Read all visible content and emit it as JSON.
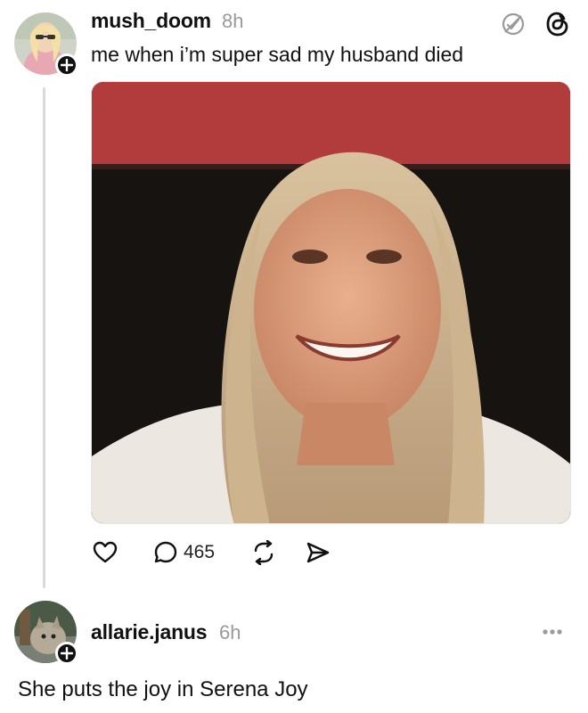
{
  "post": {
    "username": "mush_doom",
    "time": "8h",
    "text": "me when i’m super sad my husband died",
    "replies_count": "465",
    "icons": [
      "avatar",
      "follow-plus-icon",
      "muted-icon",
      "threads-logo-icon",
      "heart-icon",
      "reply-icon",
      "repost-icon",
      "share-icon"
    ]
  },
  "reply": {
    "username": "allarie.janus",
    "time": "6h",
    "text": "She puts the joy in Serena Joy",
    "icons": [
      "avatar",
      "follow-plus-icon",
      "more-icon"
    ]
  },
  "colors": {
    "text": "#111111",
    "muted": "#9a9a9a",
    "thread_line": "#d9d9d9",
    "image_red_band": "#b23b3b"
  }
}
